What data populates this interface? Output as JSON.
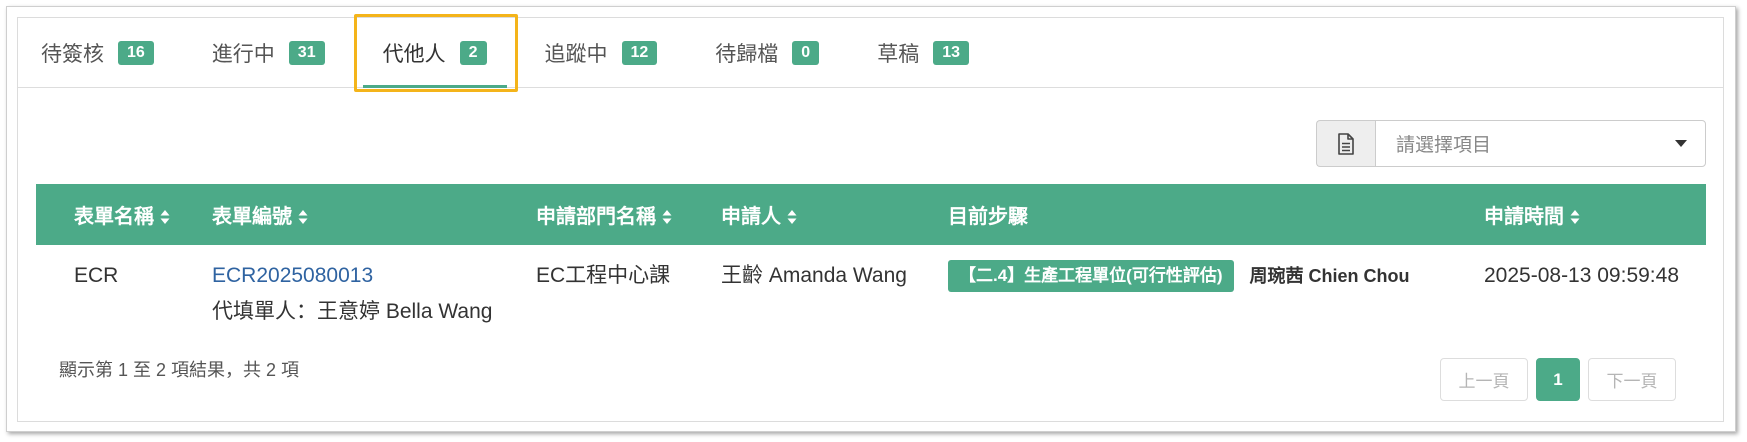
{
  "tabs": [
    {
      "label": "待簽核",
      "count": "16",
      "active": false
    },
    {
      "label": "進行中",
      "count": "31",
      "active": false
    },
    {
      "label": "代他人",
      "count": "2",
      "active": true
    },
    {
      "label": "追蹤中",
      "count": "12",
      "active": false
    },
    {
      "label": "待歸檔",
      "count": "0",
      "active": false
    },
    {
      "label": "草稿",
      "count": "13",
      "active": false
    }
  ],
  "filter": {
    "addon_icon": "document-icon",
    "placeholder": "請選擇項目",
    "caret_icon": "caret-down-icon"
  },
  "table": {
    "sort_icon": "sort-icon",
    "columns": [
      {
        "label": "表單名稱",
        "sortable": true
      },
      {
        "label": "表單編號",
        "sortable": true
      },
      {
        "label": "申請部門名稱",
        "sortable": true
      },
      {
        "label": "申請人",
        "sortable": true
      },
      {
        "label": "目前步驟",
        "sortable": false
      },
      {
        "label": "申請時間",
        "sortable": true
      }
    ],
    "rows": [
      {
        "form_name": "ECR",
        "form_number": "ECR2025080013",
        "proxy_filler": "代填單人：王意婷 Bella Wang",
        "department": "EC工程中心課",
        "applicant": "王齡 Amanda Wang",
        "current_step": "【二.4】生產工程單位(可行性評估)",
        "step_handler": "周琬茜 Chien Chou",
        "applied_at": "2025-08-13 09:59:48"
      }
    ]
  },
  "footer": {
    "summary": "顯示第 1 至 2 項結果，共 2 項"
  },
  "pagination": {
    "prev_label": "上一頁",
    "pages": [
      "1"
    ],
    "current_page": "1",
    "next_label": "下一頁",
    "prev_disabled": true,
    "next_disabled": true
  },
  "colors": {
    "accent": "#4caa88",
    "highlight": "#f4b41a",
    "link": "#2f63a1",
    "text": "#333333",
    "muted": "#555555",
    "disabled": "#b5b5b5"
  }
}
